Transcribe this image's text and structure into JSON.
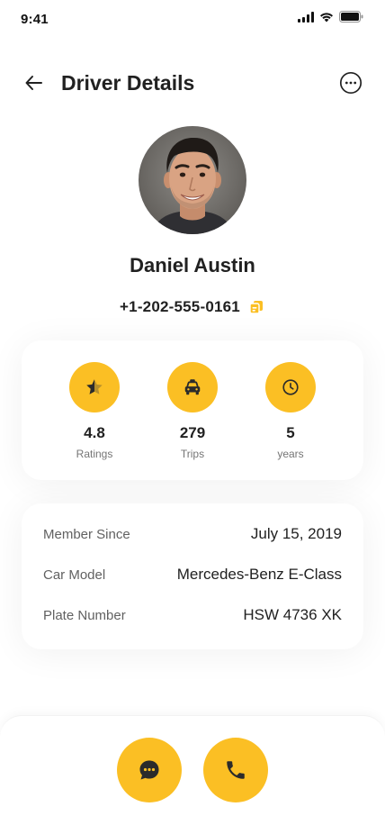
{
  "status_bar": {
    "time": "9:41"
  },
  "header": {
    "title": "Driver Details"
  },
  "driver": {
    "name": "Daniel Austin",
    "phone": "+1-202-555-0161"
  },
  "stats": [
    {
      "value": "4.8",
      "label": "Ratings",
      "icon": "star-half-icon"
    },
    {
      "value": "279",
      "label": "Trips",
      "icon": "taxi-icon"
    },
    {
      "value": "5",
      "label": "years",
      "icon": "clock-icon"
    }
  ],
  "details": [
    {
      "label": "Member Since",
      "value": "July 15, 2019"
    },
    {
      "label": "Car Model",
      "value": "Mercedes-Benz E-Class"
    },
    {
      "label": "Plate Number",
      "value": "HSW 4736 XK"
    }
  ],
  "actions": [
    {
      "icon": "chat-icon"
    },
    {
      "icon": "phone-icon"
    }
  ],
  "colors": {
    "accent": "#FBBF24",
    "text": "#212121",
    "muted": "#757575"
  }
}
